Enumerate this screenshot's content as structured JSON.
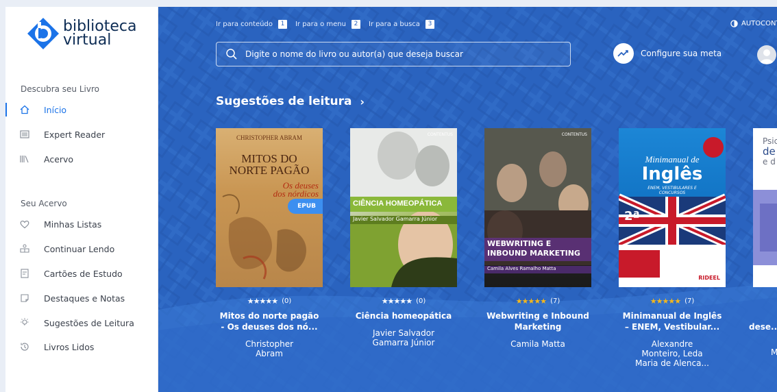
{
  "brand": {
    "line1": "biblioteca",
    "line2": "virtual"
  },
  "sidebar": {
    "section1": "Descubra seu Livro",
    "section2": "Seu Acervo",
    "items": [
      {
        "label": "Início",
        "icon": "home-icon",
        "active": true
      },
      {
        "label": "Expert Reader",
        "icon": "expert-reader-icon"
      },
      {
        "label": "Acervo",
        "icon": "library-icon"
      },
      {
        "label": "Minhas Listas",
        "icon": "heart-icon"
      },
      {
        "label": "Continuar Lendo",
        "icon": "continue-reading-icon"
      },
      {
        "label": "Cartões de Estudo",
        "icon": "study-cards-icon"
      },
      {
        "label": "Destaques e Notas",
        "icon": "highlights-icon"
      },
      {
        "label": "Sugestões de Leitura",
        "icon": "lightbulb-icon"
      },
      {
        "label": "Livros Lidos",
        "icon": "history-icon"
      }
    ]
  },
  "topbar": {
    "skip_links": [
      {
        "label": "Ir para conteúdo",
        "key": "1"
      },
      {
        "label": "Ir para o menu",
        "key": "2"
      },
      {
        "label": "Ir para a busca",
        "key": "3"
      }
    ],
    "autocontrast": "AUTOCONTRASTE",
    "search_placeholder": "Digite o nome do livro ou autor(a) que deseja buscar",
    "meta_label": "Configure sua meta"
  },
  "section": {
    "title": "Sugestões de leitura"
  },
  "books": [
    {
      "title": "Mitos do norte pagão - Os deuses dos nó...",
      "author": "Christopher Abram",
      "rating_count": "(0)",
      "stars_color": "#ffffff",
      "badge": "EPUB",
      "cover": {
        "top": "CHRISTOPHER ABRAM",
        "main1": "MITOS DO",
        "main2": "NORTE PAGÃO",
        "sub1": "Os deuses",
        "sub2": "dos nórdicos"
      }
    },
    {
      "title": "Ciência homeopática",
      "author": "Javier Salvador Gamarra Júnior",
      "rating_count": "(0)",
      "stars_color": "#ffffff",
      "cover": {
        "main1": "CIÊNCIA HOMEOPÁTICA",
        "sub1": "Javier Salvador Gamarra Júnior",
        "publisher": "CONTENTUS"
      }
    },
    {
      "title": "Webwriting e Inbound Marketing",
      "author": "Camila Matta",
      "rating_count": "(7)",
      "stars_color": "#f5b81c",
      "cover": {
        "main1": "WEBWRITING E",
        "main2": "INBOUND MARKETING",
        "sub1": "Camila Alves Ramalho Matta",
        "publisher": "CONTENTUS"
      }
    },
    {
      "title": "Minimanual de Inglês – ENEM, Vestibular...",
      "author": "Alexandre Monteiro, Leda Maria de Alenca...",
      "rating_count": "(7)",
      "stars_color": "#f5b81c",
      "cover": {
        "main1": "Minimanual de",
        "main2": "Inglês",
        "sub1": "ENEM, VESTIBULARES E CONCURSOS",
        "edition": "2ª",
        "publisher": "RIDEEL"
      }
    },
    {
      "title": "dese...",
      "author": "M",
      "rating_count": "",
      "stars_color": "#f5b81c",
      "cover": {
        "main1": "Psic",
        "main2": "de",
        "sub1": "e d"
      }
    }
  ]
}
